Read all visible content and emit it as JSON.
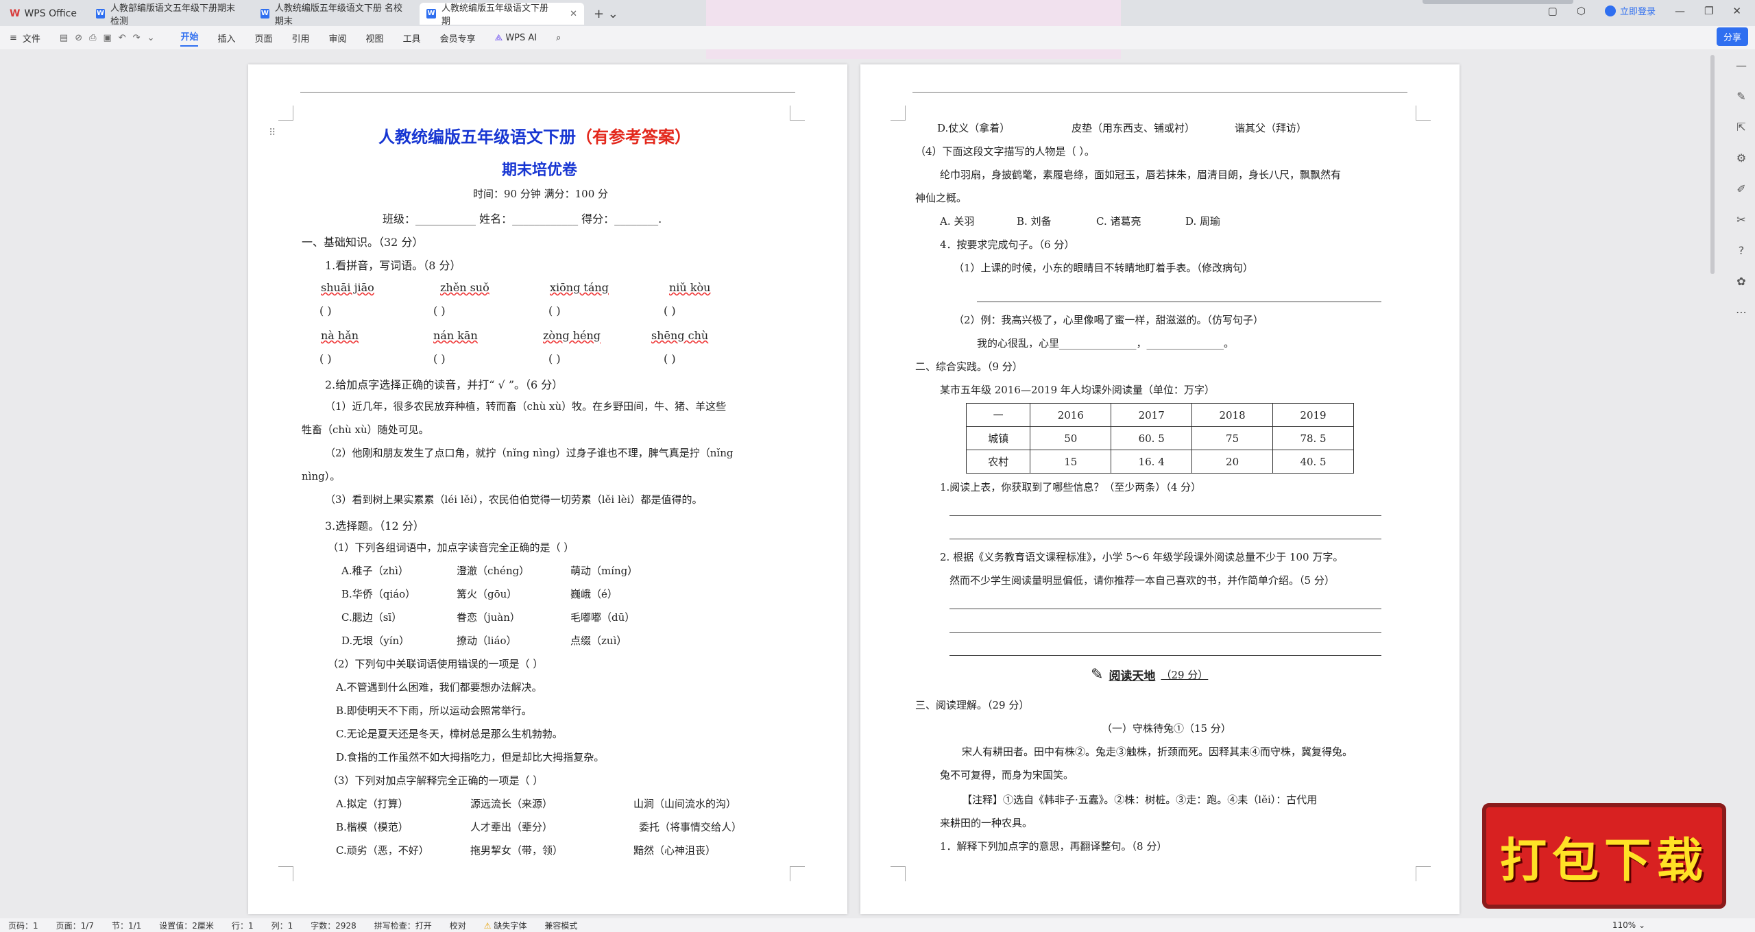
{
  "app": {
    "brand": "WPS Office",
    "tabs": [
      {
        "label": "人教部编版语文五年级下册期末检测"
      },
      {
        "label": "人教统编版五年级语文下册 名校期末"
      },
      {
        "label": "人教统编版五年级语文下册 期"
      }
    ],
    "login": "立即登录",
    "share": "分享"
  },
  "ribbon": {
    "file": "文件",
    "tabs": [
      "开始",
      "插入",
      "页面",
      "引用",
      "审阅",
      "视图",
      "工具",
      "会员专享"
    ],
    "wps_ai": "WPS AI"
  },
  "page1": {
    "title_blue": "人教统编版五年级语文下册",
    "title_red": "（有参考答案）",
    "subtitle": "期末培优卷",
    "meta": "时间：90 分钟   满分：100 分",
    "fields": "班级：___________   姓名：____________   得分：________.",
    "s1": "一、基础知识。（32 分）",
    "q1": "1.看拼音，写词语。（8 分）",
    "pinyin_row1": [
      "shuāi  jiāo",
      "zhěn  suǒ",
      "xiōng  táng",
      "niǔ  kòu"
    ],
    "pinyin_row2": [
      "nà  hǎn",
      "nán  kān",
      "zòng  héng",
      "shēng  chù"
    ],
    "bracket": "(            )",
    "q2": "2.给加点字选择正确的读音，并打“ √ ”。（6 分）",
    "q2_1a": "（1）近几年，很多农民放弃种植，转而畜（chù   xù）牧。在乡野田间，牛、猪、羊这些",
    "q2_1b": "牲畜（chù   xù）随处可见。",
    "q2_2a": "（2）他刚和朋友发生了点口角，就拧（nǐng   nìng）过身子谁也不理，脾气真是拧（nǐng",
    "q2_2b": "nìng）。",
    "q2_3": "（3）看到树上果实累累（léi   lěi），农民伯伯觉得一切劳累（lěi   lèi）都是值得的。",
    "q3": "3.选择题。（12 分）",
    "q3_1": "（1）下列各组词语中，加点字读音完全正确的是（     ）",
    "q3_1A": [
      "A.稚子（zhì）",
      "澄澈（chéng）",
      "萌动（míng）"
    ],
    "q3_1B": [
      "B.华侨（qiáo）",
      "篝火（gōu）",
      "巍峨（é）"
    ],
    "q3_1C": [
      "C.腮边（sī）",
      "眷恋（juàn）",
      "毛嘟嘟（dū）"
    ],
    "q3_1D": [
      "D.无垠（yín）",
      "撩动（liáo）",
      "点缀（zuì）"
    ],
    "q3_2": "（2）下列句中关联词语使用错误的一项是（     ）",
    "q3_2A": "A.不管遇到什么困难，我们都要想办法解决。",
    "q3_2B": "B.即使明天不下雨，所以运动会照常举行。",
    "q3_2C": "C.无论是夏天还是冬天，樟树总是那么生机勃勃。",
    "q3_2D": "D.食指的工作虽然不如大拇指吃力，但是却比大拇指复杂。",
    "q3_3": "（3）下列对加点字解释完全正确的一项是（     ）",
    "q3_3A": [
      "A.拟定（打算）",
      "源远流长（来源）",
      "山涧（山间流水的沟）"
    ],
    "q3_3B": [
      "B.楷模（模范）",
      "人才辈出（辈分）",
      "委托（将事情交给人）"
    ],
    "q3_3C": [
      "C.顽劣（恶，不好）",
      "拖男挈女（带，领）",
      "黯然（心神沮丧）"
    ]
  },
  "page2": {
    "d_line": [
      "D.仗义（拿着）",
      "皮垫（用东西支、铺或衬）",
      "谐其父（拜访）"
    ],
    "q4": "（4）下面这段文字描写的人物是（     ）。",
    "q4_t1": "纶巾羽扇，身披鹤氅，素履皂绦，面如冠玉，唇若抹朱，眉清目朗，身长八尺，飘飘然有",
    "q4_t2": "神仙之概。",
    "q4_opts": [
      "A. 关羽",
      "B. 刘备",
      "C. 诸葛亮",
      "D. 周瑜"
    ],
    "q5": "4．按要求完成句子。（6 分）",
    "q5_1": "（1）上课的时候，小东的眼睛目不转睛地盯着手表。（修改病句）",
    "q5_2": "（2）例：我高兴极了，心里像喝了蜜一样，甜滋滋的。（仿写句子）",
    "q5_2b": "我的心很乱，心里_______________，_______________。",
    "s2": "二、综合实践。（9 分）",
    "s2_intro": "某市五年级 2016—2019 年人均课外阅读量（单位：万字）",
    "table": {
      "header": [
        "一",
        "2016",
        "2017",
        "2018",
        "2019"
      ],
      "rows": [
        [
          "城镇",
          "50",
          "60. 5",
          "75",
          "78. 5"
        ],
        [
          "农村",
          "15",
          "16. 4",
          "20",
          "40. 5"
        ]
      ]
    },
    "s2_q1": "1.阅读上表，你获取到了哪些信息？（至少两条）（4 分）",
    "s2_q2a": "2. 根据《义务教育语文课程标准》，小学 5～6 年级学段课外阅读总量不少于 100 万字。",
    "s2_q2b": "然而不少学生阅读量明显偏低，请你推荐一本自己喜欢的书，并作简单介绍。（5 分）",
    "read_heading": "阅读天地",
    "read_score": "（29 分）",
    "s3": "三、阅读理解。（29 分）",
    "s3_title": "（一）守株待兔①（15 分）",
    "s3_t1": "宋人有耕田者。田中有株②。兔走③触株，折颈而死。因释其耒④而守株，冀复得兔。",
    "s3_t2": "兔不可复得，而身为宋国笑。",
    "s3_n1": "【注释】①选自《韩非子·五蠹》。②株：树桩。③走：跑。④耒（lěi）：古代用",
    "s3_n2": "来耕田的一种农具。",
    "s3_q1": "1．解释下列加点字的意思，再翻译整句。（8 分）"
  },
  "status": {
    "items": [
      "页码：1",
      "页面：1/7",
      "节：1/1",
      "设置值：2厘米",
      "行：1",
      "列：1",
      "字数：2928",
      "拼写检查：打开",
      "校对",
      "缺失字体",
      "兼容模式"
    ],
    "zoom": "110%"
  },
  "banner": "打包下载"
}
